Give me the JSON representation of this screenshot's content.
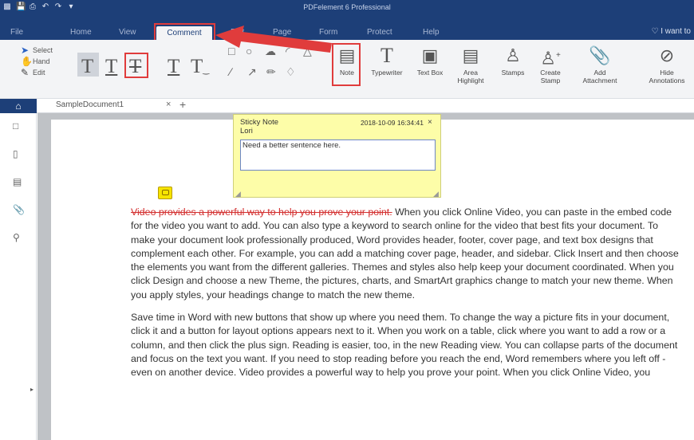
{
  "app": {
    "title": "PDFelement 6 Professional"
  },
  "quick_access": [
    "app-logo-icon",
    "save-icon",
    "print-icon",
    "undo-icon",
    "redo-icon",
    "customize-icon"
  ],
  "menu": {
    "items": [
      "File",
      "Home",
      "View",
      "Comment",
      "Edit",
      "Page",
      "Form",
      "Protect",
      "Help"
    ],
    "active": "Comment",
    "search_hint": "I want to"
  },
  "ribbon": {
    "small_tools": [
      "Select",
      "Hand",
      "Edit"
    ],
    "text_markup_tools": [
      "highlight-text-icon",
      "underline-text-icon",
      "strikethrough-text-icon",
      "replace-text-icon",
      "insert-text-icon"
    ],
    "shape_tools": [
      "rectangle-icon",
      "oval-icon",
      "cloud-icon",
      "arc-icon",
      "polygon-icon",
      "line-icon",
      "arrow-icon",
      "pencil-icon",
      "eraser-icon"
    ],
    "note": "Note",
    "typewriter": "Typewriter",
    "text_box": "Text Box",
    "area_highlight": [
      "Area",
      "Highlight"
    ],
    "stamps": "Stamps",
    "create_stamp": [
      "Create",
      "Stamp"
    ],
    "add_attachment": [
      "Add",
      "Attachment"
    ],
    "hide_annotations": [
      "Hide",
      "Annotations"
    ]
  },
  "tabs": {
    "document": "SampleDocument1",
    "close": "×",
    "add": "+"
  },
  "sidebar": {
    "icons": [
      "thumbnails-icon",
      "bookmarks-icon",
      "comments-icon",
      "attachments-icon",
      "search-icon"
    ]
  },
  "sticky_note": {
    "title": "Sticky Note",
    "author": "Lori",
    "date": "2018-10-09 16:34:41",
    "close": "×",
    "text": "Need a better sentence here."
  },
  "document": {
    "p1_strike": "Video provides a powerful way to help you prove your point.",
    "p1_rest": " When you click Online Video, you can paste in the embed code for the video you want to add. You can also type a keyword to search online for the video that best fits your document. To make your document look professionally produced, Word provides header, footer, cover page, and text box designs that complement each other. For example, you can add a matching cover page, header, and sidebar. Click Insert and then choose the elements you want from the different galleries. Themes and styles also help keep your document coordinated. When you click Design and choose a new Theme, the pictures, charts, and SmartArt graphics change to match your new theme. When you apply styles, your headings change to match the new theme.",
    "p2": "Save time in Word with new buttons that show up where you need them. To change the way a picture fits in your document, click it and a button for layout options appears next to it. When you work on a table, click where you want to add a row or a column, and then click the plus sign. Reading is easier, too, in the new Reading view. You can collapse parts of the document and focus on the text you want. If you need to stop reading before you reach the end, Word remembers where you left off - even on another device. Video provides a powerful way to help you prove your point. When you click Online Video, you"
  },
  "colors": {
    "titlebar": "#1d3f78",
    "highlight_box": "#e03c3c",
    "sticky_bg": "#fdfda8",
    "strike": "#d32f2f"
  }
}
